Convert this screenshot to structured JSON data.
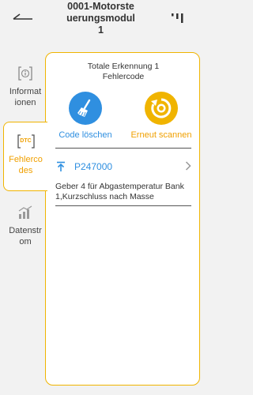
{
  "header": {
    "title": "0001-Motorste\nuerungsmodul\n1"
  },
  "sidebar": {
    "items": [
      {
        "label": "Informat\nionen",
        "icon": "info-doc-icon"
      },
      {
        "label": "Fehlerco\ndes",
        "icon": "dtc-icon",
        "icon_text": "DTC",
        "active": true
      },
      {
        "label": "Datenstr\nom",
        "icon": "data-stream-icon"
      }
    ]
  },
  "panel": {
    "summary": "Totale Erkennung 1\nFehlercode",
    "actions": {
      "clear_label": "Code löschen",
      "rescan_label": "Erneut scannen"
    },
    "codes": [
      {
        "code": "P247000",
        "description": "Geber 4 für Abgastemperatur Bank 1,Kurzschluss nach Masse"
      }
    ]
  },
  "colors": {
    "accent_yellow": "#f0b400",
    "accent_blue": "#2f8fe0",
    "background": "#f2f2f2"
  }
}
